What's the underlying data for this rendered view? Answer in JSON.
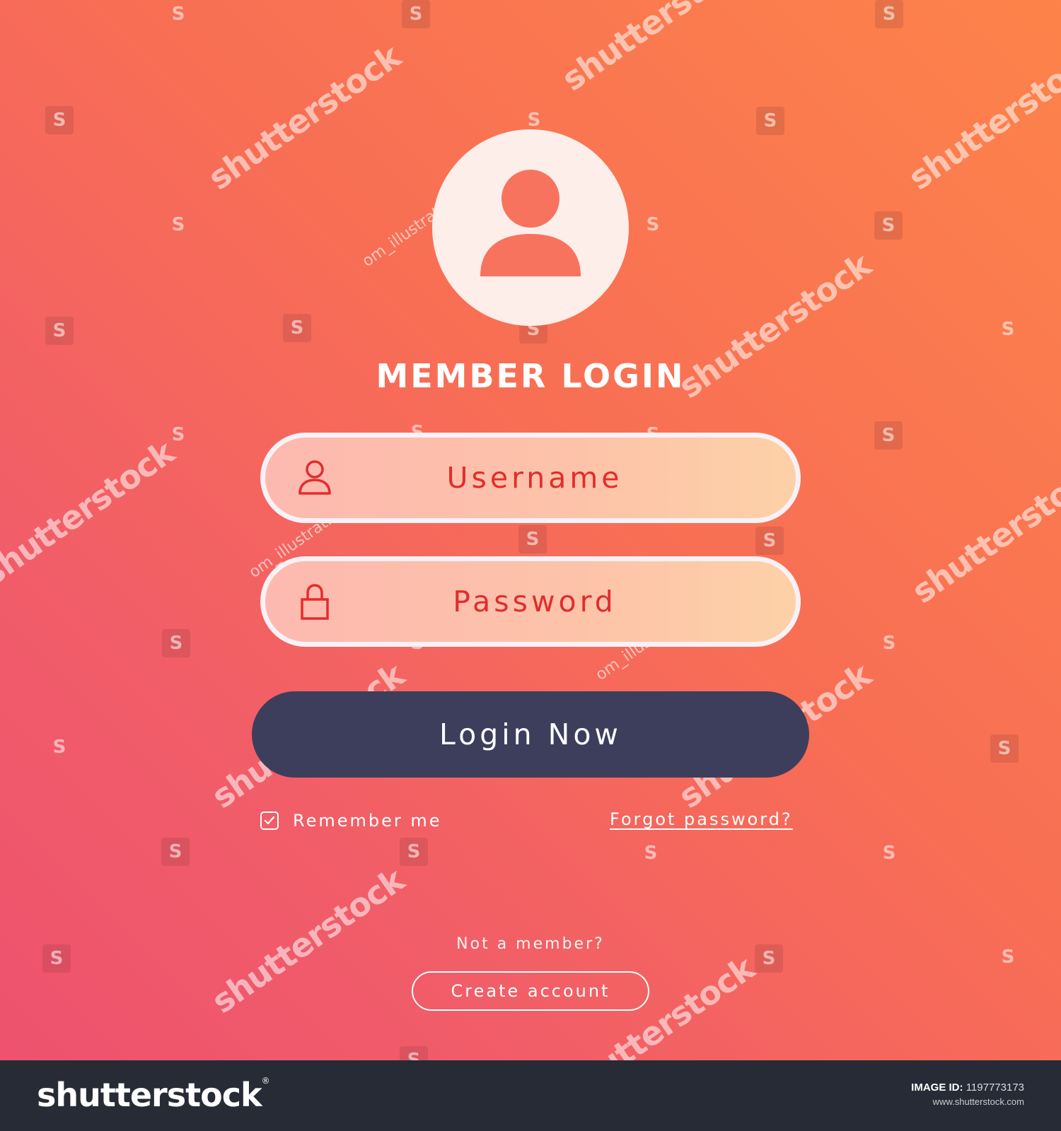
{
  "colors": {
    "gradient_top_right": "#fd834a",
    "gradient_bottom_left": "#ee526f",
    "avatar_bg": "#fdeeea",
    "avatar_glyph": "#f8735e",
    "field_border": "#f8f1f6",
    "field_text": "#e32c2c",
    "login_button_bg": "#3d3e5b",
    "footer_bg": "#262b35"
  },
  "avatar": {
    "icon": "user-avatar-icon"
  },
  "title": "MEMBER LOGIN",
  "username_field": {
    "icon": "user-icon",
    "placeholder": "Username"
  },
  "password_field": {
    "icon": "lock-icon",
    "placeholder": "Password"
  },
  "login_button": {
    "label": "Login Now"
  },
  "remember": {
    "label": "Remember me",
    "checked": true
  },
  "forgot_link": {
    "label": "Forgot password?"
  },
  "signup": {
    "prompt": "Not a member?",
    "button_label": "Create account"
  },
  "watermark": {
    "brand": "shutterstock",
    "contributor": "om_illustrations"
  },
  "footer": {
    "logo": "shutterstock",
    "logo_mark": "®",
    "image_id_label": "IMAGE ID:",
    "image_id": "1197773173",
    "url": "www.shutterstock.com"
  }
}
